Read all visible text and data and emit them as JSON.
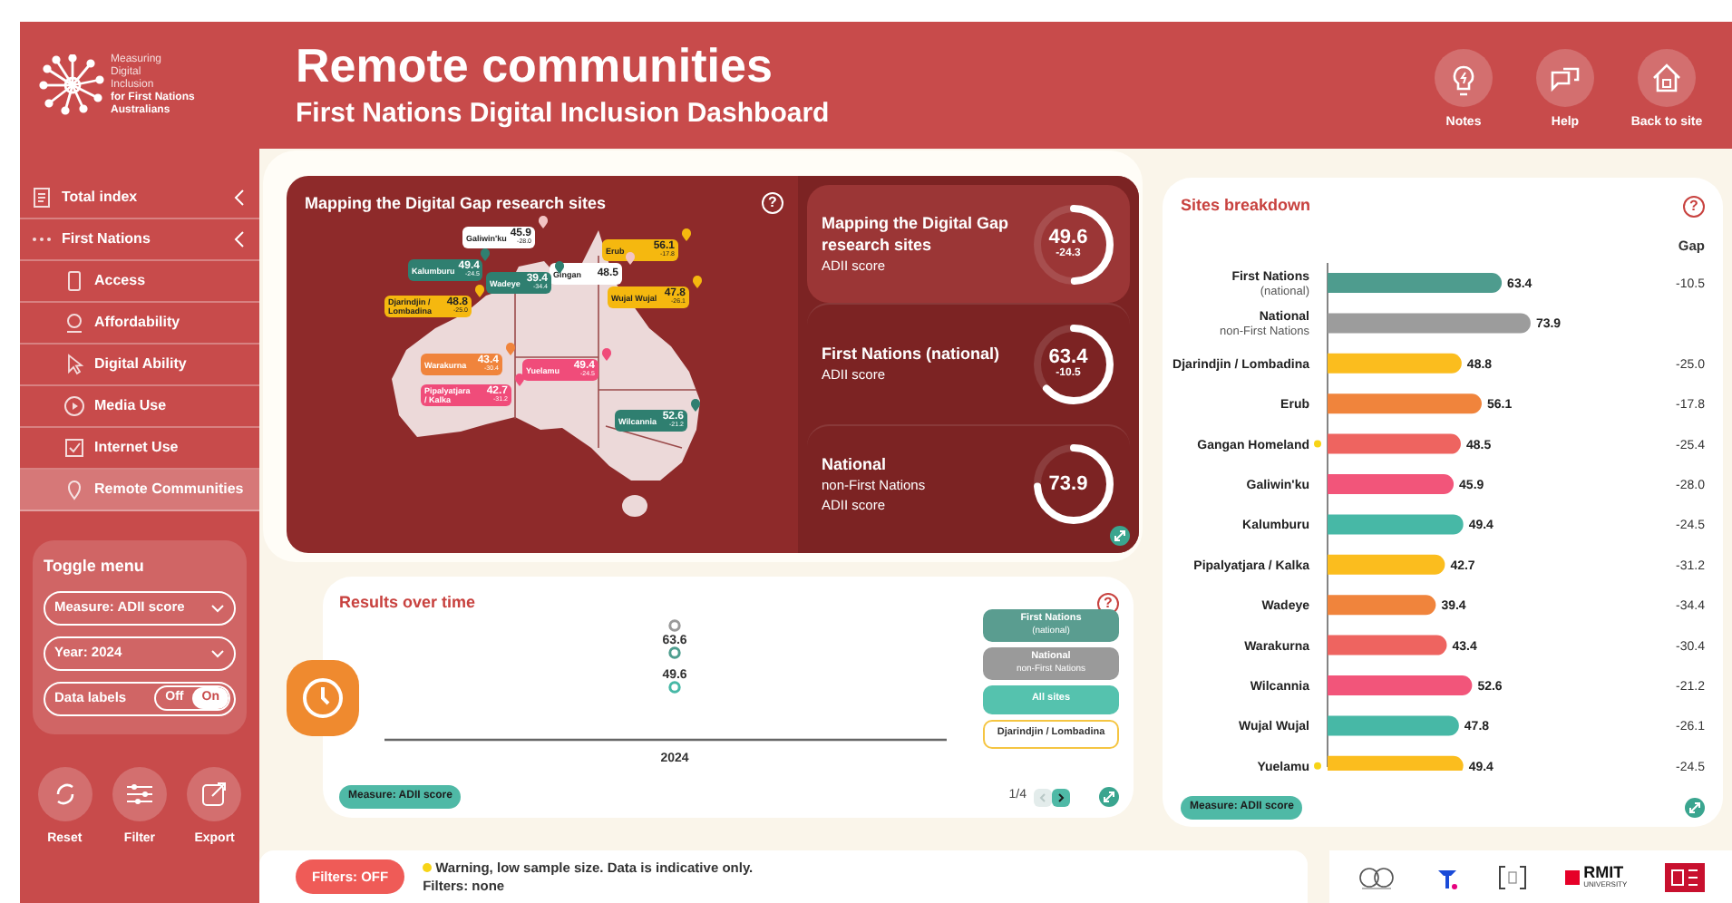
{
  "header": {
    "logo_light": [
      "Measuring",
      "Digital",
      "Inclusion"
    ],
    "logo_bold": [
      "for First Nations",
      "Australians"
    ],
    "title": "Remote communities",
    "subtitle": "First Nations Digital Inclusion Dashboard",
    "actions": [
      {
        "label": "Notes"
      },
      {
        "label": "Help"
      },
      {
        "label": "Back to site"
      }
    ]
  },
  "sidebar": {
    "nav": [
      {
        "label": "Total index",
        "kind": "section",
        "selected": false
      },
      {
        "label": "First Nations",
        "kind": "section",
        "selected": false
      },
      {
        "label": "Access",
        "kind": "item",
        "selected": false
      },
      {
        "label": "Affordability",
        "kind": "item",
        "selected": false
      },
      {
        "label": "Digital Ability",
        "kind": "item",
        "selected": false
      },
      {
        "label": "Media Use",
        "kind": "item",
        "selected": false
      },
      {
        "label": "Internet Use",
        "kind": "item",
        "selected": false
      },
      {
        "label": "Remote Communities",
        "kind": "item",
        "selected": true
      }
    ],
    "toggle_menu": {
      "title": "Toggle menu",
      "measure": "Measure: ADII score",
      "year": "Year: 2024",
      "data_labels": {
        "label": "Data labels",
        "options": [
          {
            "label": "Off",
            "selected": false
          },
          {
            "label": "On",
            "selected": true
          }
        ]
      }
    },
    "tools": [
      {
        "label": "Reset"
      },
      {
        "label": "Filter"
      },
      {
        "label": "Export"
      }
    ]
  },
  "map_panel": {
    "title": "Mapping the Digital Gap research sites",
    "help": "?",
    "sites": [
      {
        "name": "Galiwin'ku",
        "value": "45.9",
        "gap": "-28.0",
        "color": "#ffffff"
      },
      {
        "name": "Erub",
        "value": "56.1",
        "gap": "-17.8",
        "color": "#f5b80f"
      },
      {
        "name": "Kalumburu",
        "value": "49.4",
        "gap": "-24.5",
        "color": "#2f7f70"
      },
      {
        "name": "Gingan",
        "value": "48.5",
        "color": "#ffffff"
      },
      {
        "name": "Wadeye",
        "value": "39.4",
        "gap": "-34.4",
        "color": "#2f7f70"
      },
      {
        "name": "Wujal Wujal",
        "value": "47.8",
        "gap": "-26.1",
        "color": "#f5b80f"
      },
      {
        "name": "Djarindjin / Lombadina",
        "value": "48.8",
        "gap": "-25.0",
        "color": "#f5b80f"
      },
      {
        "name": "Warakurna",
        "value": "43.4",
        "gap": "-30.4",
        "color": "#f0843c"
      },
      {
        "name": "Yuelamu",
        "value": "49.4",
        "gap": "-24.5",
        "color": "#f04c7a"
      },
      {
        "name": "Pipalyatjara / Kalka",
        "value": "42.7",
        "gap": "-31.2",
        "color": "#f04c7a"
      },
      {
        "name": "Wilcannia",
        "value": "52.6",
        "gap": "-21.2",
        "color": "#2f7f70"
      }
    ],
    "scores": [
      {
        "title": "Mapping the Digital Gap research sites",
        "lines": [
          "ADII score"
        ],
        "value": "49.6",
        "gap": "-24.3",
        "level": 0.496,
        "selected": true
      },
      {
        "title": "First Nations (national)",
        "lines": [
          "ADII score"
        ],
        "value": "63.4",
        "gap": "-10.5",
        "level": 0.634,
        "selected": false
      },
      {
        "title": "National",
        "lines": [
          "non-First Nations",
          "ADII score"
        ],
        "value": "73.9",
        "level": 0.739,
        "selected": false
      }
    ]
  },
  "results": {
    "title": "Results over time",
    "help": "?",
    "chart": {
      "x_label": "2024",
      "points": [
        {
          "color": "#9a9a9a"
        },
        {
          "color": "#4f9e8f",
          "label": "63.6"
        },
        {
          "color": "#47b8a6",
          "label": "49.6"
        }
      ]
    },
    "legend": [
      {
        "title": "First Nations",
        "subtitle": "(national)",
        "color": "#5a9d90",
        "selected": true
      },
      {
        "title": "National",
        "subtitle": "non-First Nations",
        "color": "#9a9a9a",
        "selected": true
      },
      {
        "title": "All sites",
        "color": "#55c2ae",
        "selected": true
      },
      {
        "title": "Djarindjin / Lombadina",
        "color": "#f5c542",
        "selected": false
      }
    ],
    "measure": "Measure: ADII score",
    "pager": {
      "text": "1/4",
      "prev_disabled": true
    }
  },
  "sites": {
    "title": "Sites breakdown",
    "help": "?",
    "gap_header": "Gap",
    "chart_data": {
      "type": "bar",
      "orientation": "horizontal",
      "categories": [
        "First Nations",
        "National",
        "Djarindjin / Lombadina",
        "Erub",
        "Gangan Homeland",
        "Galiwin'ku",
        "Kalumburu",
        "Pipalyatjara / Kalka",
        "Wadeye",
        "Warakurna",
        "Wilcannia",
        "Wujal Wujal",
        "Yuelamu"
      ],
      "series": [
        {
          "values": [
            63.4,
            73.9,
            48.8,
            56.1,
            48.5,
            45.9,
            49.4,
            42.7,
            39.4,
            43.4,
            52.6,
            47.8,
            49.4
          ]
        }
      ],
      "data_labels": true
    },
    "rows": [
      {
        "sublabel": "(national)",
        "gap": "-10.5",
        "color": "#4e9c8e",
        "warning": false
      },
      {
        "sublabel": "non-First Nations",
        "color": "#9c9c9c",
        "warning": false
      },
      {
        "gap": "-25.0",
        "color": "#fbbd1e",
        "warning": false
      },
      {
        "gap": "-17.8",
        "color": "#f0843c",
        "warning": false
      },
      {
        "gap": "-25.4",
        "color": "#ee6460",
        "warning": true
      },
      {
        "gap": "-28.0",
        "color": "#f2557a",
        "warning": false
      },
      {
        "gap": "-24.5",
        "color": "#47b8a6",
        "warning": false
      },
      {
        "gap": "-31.2",
        "color": "#fbbd1e",
        "warning": false
      },
      {
        "gap": "-34.4",
        "color": "#f0843c",
        "warning": false
      },
      {
        "gap": "-30.4",
        "color": "#ee6460",
        "warning": false
      },
      {
        "gap": "-21.2",
        "color": "#f2557a",
        "warning": false
      },
      {
        "gap": "-26.1",
        "color": "#47b8a6",
        "warning": false
      },
      {
        "gap": "-24.5",
        "color": "#fbbd1e",
        "warning": true
      }
    ],
    "measure": "Measure: ADII score"
  },
  "footer": {
    "filters": "Filters: OFF",
    "warning": "Warning, low sample size. Data is indicative only.",
    "filters_note": "Filters: none"
  },
  "partners": {
    "rmit": "RMIT",
    "rmit_sub": "UNIVERSITY"
  }
}
